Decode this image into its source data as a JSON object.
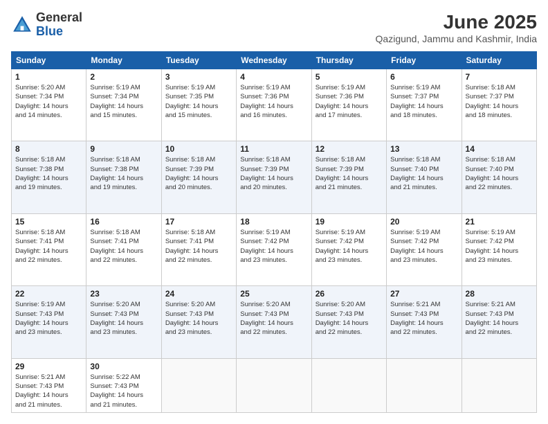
{
  "logo": {
    "line1": "General",
    "line2": "Blue"
  },
  "title": {
    "month_year": "June 2025",
    "location": "Qazigund, Jammu and Kashmir, India"
  },
  "days_of_week": [
    "Sunday",
    "Monday",
    "Tuesday",
    "Wednesday",
    "Thursday",
    "Friday",
    "Saturday"
  ],
  "weeks": [
    [
      {
        "day": "1",
        "info": "Sunrise: 5:20 AM\nSunset: 7:34 PM\nDaylight: 14 hours\nand 14 minutes."
      },
      {
        "day": "2",
        "info": "Sunrise: 5:19 AM\nSunset: 7:34 PM\nDaylight: 14 hours\nand 15 minutes."
      },
      {
        "day": "3",
        "info": "Sunrise: 5:19 AM\nSunset: 7:35 PM\nDaylight: 14 hours\nand 15 minutes."
      },
      {
        "day": "4",
        "info": "Sunrise: 5:19 AM\nSunset: 7:36 PM\nDaylight: 14 hours\nand 16 minutes."
      },
      {
        "day": "5",
        "info": "Sunrise: 5:19 AM\nSunset: 7:36 PM\nDaylight: 14 hours\nand 17 minutes."
      },
      {
        "day": "6",
        "info": "Sunrise: 5:19 AM\nSunset: 7:37 PM\nDaylight: 14 hours\nand 18 minutes."
      },
      {
        "day": "7",
        "info": "Sunrise: 5:18 AM\nSunset: 7:37 PM\nDaylight: 14 hours\nand 18 minutes."
      }
    ],
    [
      {
        "day": "8",
        "info": "Sunrise: 5:18 AM\nSunset: 7:38 PM\nDaylight: 14 hours\nand 19 minutes."
      },
      {
        "day": "9",
        "info": "Sunrise: 5:18 AM\nSunset: 7:38 PM\nDaylight: 14 hours\nand 19 minutes."
      },
      {
        "day": "10",
        "info": "Sunrise: 5:18 AM\nSunset: 7:39 PM\nDaylight: 14 hours\nand 20 minutes."
      },
      {
        "day": "11",
        "info": "Sunrise: 5:18 AM\nSunset: 7:39 PM\nDaylight: 14 hours\nand 20 minutes."
      },
      {
        "day": "12",
        "info": "Sunrise: 5:18 AM\nSunset: 7:39 PM\nDaylight: 14 hours\nand 21 minutes."
      },
      {
        "day": "13",
        "info": "Sunrise: 5:18 AM\nSunset: 7:40 PM\nDaylight: 14 hours\nand 21 minutes."
      },
      {
        "day": "14",
        "info": "Sunrise: 5:18 AM\nSunset: 7:40 PM\nDaylight: 14 hours\nand 22 minutes."
      }
    ],
    [
      {
        "day": "15",
        "info": "Sunrise: 5:18 AM\nSunset: 7:41 PM\nDaylight: 14 hours\nand 22 minutes."
      },
      {
        "day": "16",
        "info": "Sunrise: 5:18 AM\nSunset: 7:41 PM\nDaylight: 14 hours\nand 22 minutes."
      },
      {
        "day": "17",
        "info": "Sunrise: 5:18 AM\nSunset: 7:41 PM\nDaylight: 14 hours\nand 22 minutes."
      },
      {
        "day": "18",
        "info": "Sunrise: 5:19 AM\nSunset: 7:42 PM\nDaylight: 14 hours\nand 23 minutes."
      },
      {
        "day": "19",
        "info": "Sunrise: 5:19 AM\nSunset: 7:42 PM\nDaylight: 14 hours\nand 23 minutes."
      },
      {
        "day": "20",
        "info": "Sunrise: 5:19 AM\nSunset: 7:42 PM\nDaylight: 14 hours\nand 23 minutes."
      },
      {
        "day": "21",
        "info": "Sunrise: 5:19 AM\nSunset: 7:42 PM\nDaylight: 14 hours\nand 23 minutes."
      }
    ],
    [
      {
        "day": "22",
        "info": "Sunrise: 5:19 AM\nSunset: 7:43 PM\nDaylight: 14 hours\nand 23 minutes."
      },
      {
        "day": "23",
        "info": "Sunrise: 5:20 AM\nSunset: 7:43 PM\nDaylight: 14 hours\nand 23 minutes."
      },
      {
        "day": "24",
        "info": "Sunrise: 5:20 AM\nSunset: 7:43 PM\nDaylight: 14 hours\nand 23 minutes."
      },
      {
        "day": "25",
        "info": "Sunrise: 5:20 AM\nSunset: 7:43 PM\nDaylight: 14 hours\nand 22 minutes."
      },
      {
        "day": "26",
        "info": "Sunrise: 5:20 AM\nSunset: 7:43 PM\nDaylight: 14 hours\nand 22 minutes."
      },
      {
        "day": "27",
        "info": "Sunrise: 5:21 AM\nSunset: 7:43 PM\nDaylight: 14 hours\nand 22 minutes."
      },
      {
        "day": "28",
        "info": "Sunrise: 5:21 AM\nSunset: 7:43 PM\nDaylight: 14 hours\nand 22 minutes."
      }
    ],
    [
      {
        "day": "29",
        "info": "Sunrise: 5:21 AM\nSunset: 7:43 PM\nDaylight: 14 hours\nand 21 minutes."
      },
      {
        "day": "30",
        "info": "Sunrise: 5:22 AM\nSunset: 7:43 PM\nDaylight: 14 hours\nand 21 minutes."
      },
      {
        "day": "",
        "info": ""
      },
      {
        "day": "",
        "info": ""
      },
      {
        "day": "",
        "info": ""
      },
      {
        "day": "",
        "info": ""
      },
      {
        "day": "",
        "info": ""
      }
    ]
  ]
}
